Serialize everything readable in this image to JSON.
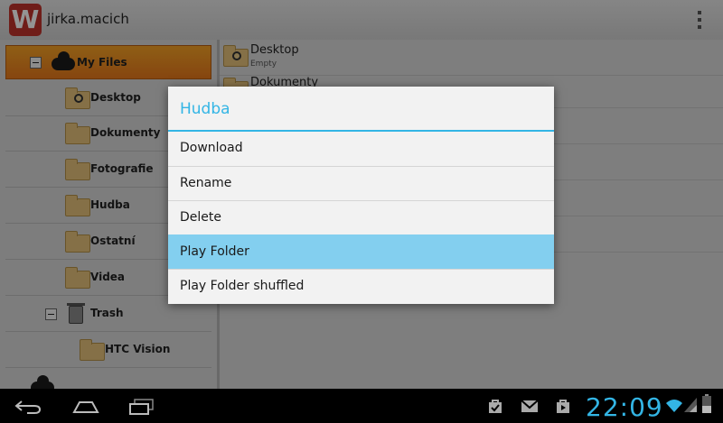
{
  "action_bar": {
    "logo_letter": "W",
    "account_name": "jirka.macich"
  },
  "tree": {
    "root": {
      "label": "My Files"
    },
    "items": [
      {
        "label": "Desktop",
        "icon": "desktop-folder-icon"
      },
      {
        "label": "Dokumenty",
        "icon": "folder-icon"
      },
      {
        "label": "Fotografie",
        "icon": "folder-icon"
      },
      {
        "label": "Hudba",
        "icon": "folder-icon"
      },
      {
        "label": "Ostatní",
        "icon": "folder-icon"
      },
      {
        "label": "Videa",
        "icon": "folder-icon"
      }
    ],
    "trash": {
      "label": "Trash"
    },
    "trash_children": [
      {
        "label": "HTC Vision"
      }
    ]
  },
  "list": {
    "rows": [
      {
        "name": "Desktop",
        "meta": "Empty"
      },
      {
        "name": "Dokumenty",
        "meta": ""
      }
    ]
  },
  "dialog": {
    "title": "Hudba",
    "items": [
      {
        "label": "Download"
      },
      {
        "label": "Rename"
      },
      {
        "label": "Delete"
      },
      {
        "label": "Play Folder",
        "highlighted": true
      },
      {
        "label": "Play Folder shuffled"
      }
    ]
  },
  "system_bar": {
    "time": "22:09"
  },
  "colors": {
    "accent": "#33b5e5",
    "highlight": "#83cfef",
    "selected_orange": "#f39a24",
    "logo_red": "#c0322b"
  }
}
